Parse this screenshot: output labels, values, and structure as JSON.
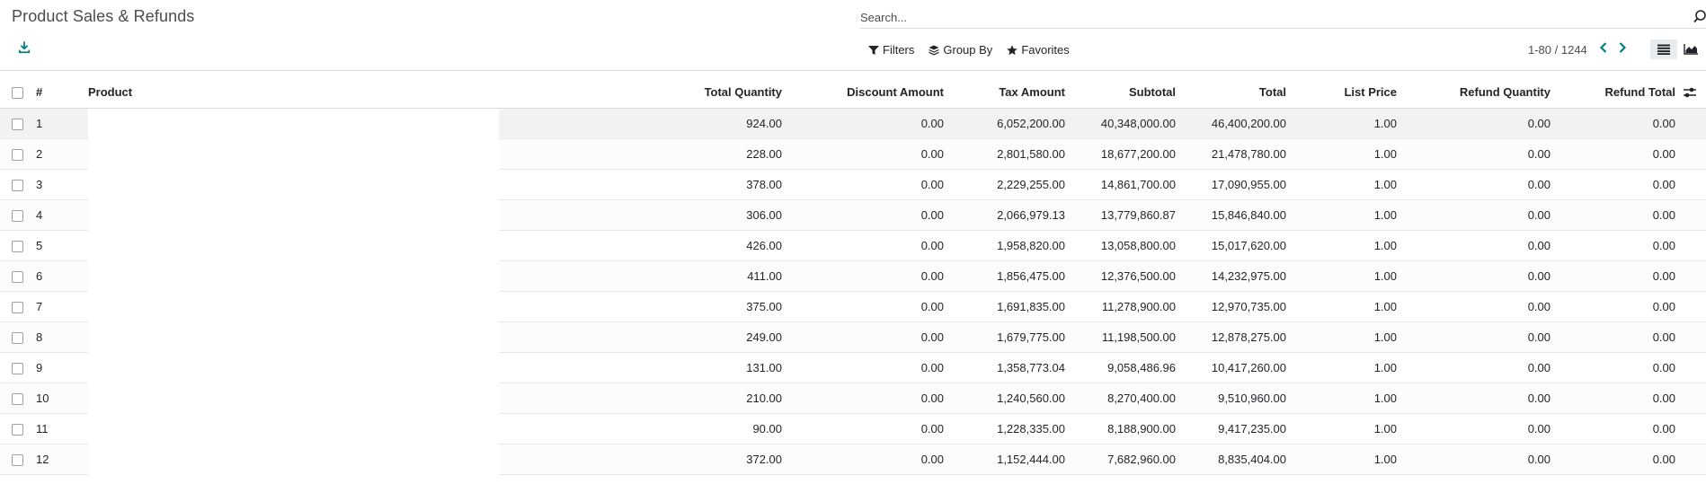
{
  "header": {
    "title": "Product Sales & Refunds"
  },
  "search": {
    "placeholder": "Search..."
  },
  "filters": {
    "filters_label": "Filters",
    "group_by_label": "Group By",
    "favorites_label": "Favorites"
  },
  "pager": {
    "text": "1-80 / 1244"
  },
  "table": {
    "columns": {
      "number": "#",
      "product": "Product",
      "total_quantity": "Total Quantity",
      "discount_amount": "Discount Amount",
      "tax_amount": "Tax Amount",
      "subtotal": "Subtotal",
      "total": "Total",
      "list_price": "List Price",
      "refund_quantity": "Refund Quantity",
      "refund_total": "Refund Total"
    },
    "rows": [
      {
        "n": "1",
        "qty": "924.00",
        "disc": "0.00",
        "tax": "6,052,200.00",
        "sub": "40,348,000.00",
        "total": "46,400,200.00",
        "list": "1.00",
        "rqty": "0.00",
        "rtot": "0.00"
      },
      {
        "n": "2",
        "qty": "228.00",
        "disc": "0.00",
        "tax": "2,801,580.00",
        "sub": "18,677,200.00",
        "total": "21,478,780.00",
        "list": "1.00",
        "rqty": "0.00",
        "rtot": "0.00"
      },
      {
        "n": "3",
        "qty": "378.00",
        "disc": "0.00",
        "tax": "2,229,255.00",
        "sub": "14,861,700.00",
        "total": "17,090,955.00",
        "list": "1.00",
        "rqty": "0.00",
        "rtot": "0.00"
      },
      {
        "n": "4",
        "qty": "306.00",
        "disc": "0.00",
        "tax": "2,066,979.13",
        "sub": "13,779,860.87",
        "total": "15,846,840.00",
        "list": "1.00",
        "rqty": "0.00",
        "rtot": "0.00"
      },
      {
        "n": "5",
        "qty": "426.00",
        "disc": "0.00",
        "tax": "1,958,820.00",
        "sub": "13,058,800.00",
        "total": "15,017,620.00",
        "list": "1.00",
        "rqty": "0.00",
        "rtot": "0.00"
      },
      {
        "n": "6",
        "qty": "411.00",
        "disc": "0.00",
        "tax": "1,856,475.00",
        "sub": "12,376,500.00",
        "total": "14,232,975.00",
        "list": "1.00",
        "rqty": "0.00",
        "rtot": "0.00"
      },
      {
        "n": "7",
        "qty": "375.00",
        "disc": "0.00",
        "tax": "1,691,835.00",
        "sub": "11,278,900.00",
        "total": "12,970,735.00",
        "list": "1.00",
        "rqty": "0.00",
        "rtot": "0.00"
      },
      {
        "n": "8",
        "qty": "249.00",
        "disc": "0.00",
        "tax": "1,679,775.00",
        "sub": "11,198,500.00",
        "total": "12,878,275.00",
        "list": "1.00",
        "rqty": "0.00",
        "rtot": "0.00"
      },
      {
        "n": "9",
        "qty": "131.00",
        "disc": "0.00",
        "tax": "1,358,773.04",
        "sub": "9,058,486.96",
        "total": "10,417,260.00",
        "list": "1.00",
        "rqty": "0.00",
        "rtot": "0.00"
      },
      {
        "n": "10",
        "qty": "210.00",
        "disc": "0.00",
        "tax": "1,240,560.00",
        "sub": "8,270,400.00",
        "total": "9,510,960.00",
        "list": "1.00",
        "rqty": "0.00",
        "rtot": "0.00"
      },
      {
        "n": "11",
        "qty": "90.00",
        "disc": "0.00",
        "tax": "1,228,335.00",
        "sub": "8,188,900.00",
        "total": "9,417,235.00",
        "list": "1.00",
        "rqty": "0.00",
        "rtot": "0.00"
      },
      {
        "n": "12",
        "qty": "372.00",
        "disc": "0.00",
        "tax": "1,152,444.00",
        "sub": "7,682,960.00",
        "total": "8,835,404.00",
        "list": "1.00",
        "rqty": "0.00",
        "rtot": "0.00"
      }
    ]
  },
  "icons": {
    "download": "download-icon",
    "search": "search-icon",
    "filter": "filter-icon",
    "group_by": "layers-icon",
    "favorites": "star-icon",
    "prev": "chevron-left-icon",
    "next": "chevron-right-icon",
    "list_view": "list-view-icon",
    "graph_view": "graph-view-icon",
    "optional_columns": "sliders-icon"
  },
  "colors": {
    "accent": "#017e84",
    "border": "#d8dadd",
    "hover_row": "#f2f2f2"
  }
}
